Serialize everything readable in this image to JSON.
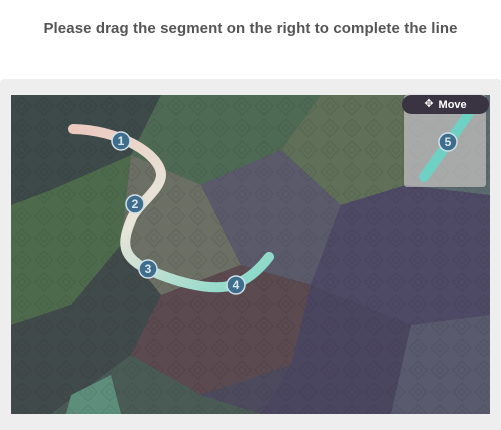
{
  "instruction": "Please drag the segment on the right to complete the line",
  "move_button": {
    "label": "Move",
    "icon": "move-arrows-icon"
  },
  "path_points": [
    {
      "number": "1"
    },
    {
      "number": "2"
    },
    {
      "number": "3"
    },
    {
      "number": "4"
    }
  ],
  "segment_piece": {
    "number": "5"
  },
  "colors": {
    "panel_background": "#eeeeee",
    "node_fill": "#3f6e8c",
    "line_start": "#e9c9bd",
    "line_end": "#8fd8c8",
    "segment_color": "#6fd0c4",
    "move_button_background": "#3a3342"
  }
}
